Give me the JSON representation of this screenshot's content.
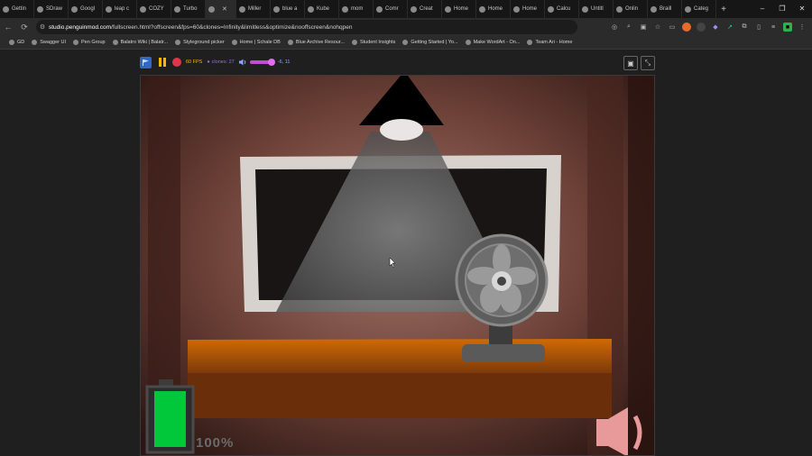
{
  "browser": {
    "tabs": [
      {
        "label": "Gettin"
      },
      {
        "label": "SDraw"
      },
      {
        "label": "Googl"
      },
      {
        "label": "leap c"
      },
      {
        "label": "COZY"
      },
      {
        "label": "Turbo"
      },
      {
        "label": "",
        "active": true
      },
      {
        "label": "Miller"
      },
      {
        "label": "blue a"
      },
      {
        "label": "Kube"
      },
      {
        "label": "mom"
      },
      {
        "label": "Comr"
      },
      {
        "label": "Creat"
      },
      {
        "label": "Home"
      },
      {
        "label": "Home"
      },
      {
        "label": "Home"
      },
      {
        "label": "Calcu"
      },
      {
        "label": "Untitl"
      },
      {
        "label": "Onlin"
      },
      {
        "label": "Braill"
      },
      {
        "label": "Categ"
      }
    ],
    "new_tab": "+",
    "window_controls": [
      "–",
      "❐",
      "✕"
    ],
    "url_domain": "studio.penguinmod.com",
    "url_rest": "/fullscreen.html?offscreen&fps=60&clones=Infinity&limitless&optimize&nooffscreen&nohqpen",
    "bookmarks": [
      {
        "label": "GD"
      },
      {
        "label": "Swagger UI"
      },
      {
        "label": "Pen Group"
      },
      {
        "label": "Balatro Wiki | Balatr..."
      },
      {
        "label": "Styleground picker"
      },
      {
        "label": "Home | Schale DB"
      },
      {
        "label": "Blue Archive Resour..."
      },
      {
        "label": "Student Insights"
      },
      {
        "label": "Getting Started | Yo..."
      },
      {
        "label": "Make WordArt - On..."
      },
      {
        "label": "Team Ari - Home"
      }
    ]
  },
  "player": {
    "fps": "60 FPS",
    "clones": "clones: 27",
    "coords": "-6, 11",
    "volume": 0.85
  },
  "game": {
    "battery_text": "100%",
    "battery_level": 1.0,
    "colors": {
      "battery": "#00c83a",
      "speaker": "#e89a9a",
      "desk": "#c25a00"
    }
  }
}
